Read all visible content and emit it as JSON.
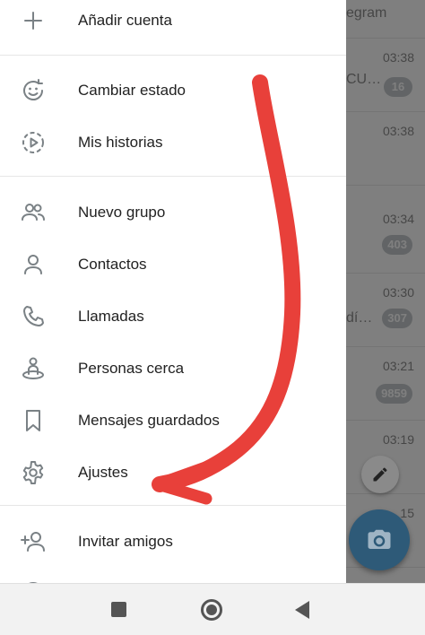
{
  "drawer": {
    "add_account": "Añadir cuenta",
    "change_status": "Cambiar estado",
    "my_stories": "Mis historias",
    "new_group": "Nuevo grupo",
    "contacts": "Contactos",
    "calls": "Llamadas",
    "people_nearby": "Personas cerca",
    "saved_messages": "Mensajes guardados",
    "settings": "Ajustes",
    "invite_friends": "Invitar amigos"
  },
  "chats": [
    {
      "time": "",
      "snippet": "egram",
      "badge": ""
    },
    {
      "time": "03:38",
      "snippet": "CU…",
      "badge": "16"
    },
    {
      "time": "03:38",
      "snippet": "",
      "badge": ""
    },
    {
      "time": "03:34",
      "snippet": "",
      "badge": "403"
    },
    {
      "time": "03:30",
      "snippet": "dí…",
      "badge": "307"
    },
    {
      "time": "03:21",
      "snippet": "",
      "badge": "9859"
    },
    {
      "time": "03:19",
      "snippet": "",
      "badge": ""
    },
    {
      "time": "15",
      "snippet": "",
      "badge": ""
    }
  ],
  "icons": {
    "add_account": "plus-icon",
    "change_status": "smiley-cycle-icon",
    "my_stories": "story-play-icon",
    "new_group": "group-icon",
    "contacts": "person-icon",
    "calls": "phone-icon",
    "people_nearby": "nearby-person-icon",
    "saved_messages": "bookmark-icon",
    "settings": "gear-icon",
    "invite_friends": "add-person-icon",
    "fab_small": "pencil-icon",
    "fab_big": "camera-icon"
  },
  "colors": {
    "annotation_arrow": "#e8403a",
    "camera_fab": "#2e5a78",
    "icon_gray": "#7a8185"
  }
}
